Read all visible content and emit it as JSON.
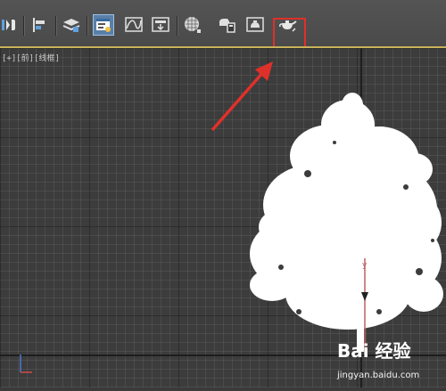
{
  "toolbar": {
    "buttons": [
      {
        "id": "mirror",
        "icon": "mirror-icon"
      },
      {
        "id": "align",
        "icon": "align-icon"
      },
      {
        "id": "layers",
        "icon": "layer-manager-icon"
      },
      {
        "id": "scene-explorer",
        "icon": "scene-explorer-icon",
        "active": true
      },
      {
        "id": "curve-editor",
        "icon": "curve-editor-icon"
      },
      {
        "id": "schematic",
        "icon": "schematic-view-icon"
      },
      {
        "id": "material-editor",
        "icon": "material-editor-icon"
      },
      {
        "id": "render-setup",
        "icon": "render-setup-icon"
      },
      {
        "id": "rendered-frame",
        "icon": "rendered-frame-window-icon"
      },
      {
        "id": "render-production",
        "icon": "render-teapot-icon"
      }
    ]
  },
  "viewport": {
    "label_plus": "[+]",
    "label_view": "[前]",
    "label_mode": "[线框]"
  },
  "watermark": {
    "logo": "Bai 经验",
    "url": "jingyan.baidu.com"
  },
  "colors": {
    "highlight": "#e0302a",
    "viewport_bg": "#3c3c3c",
    "active_view_border": "#c8b25a"
  }
}
